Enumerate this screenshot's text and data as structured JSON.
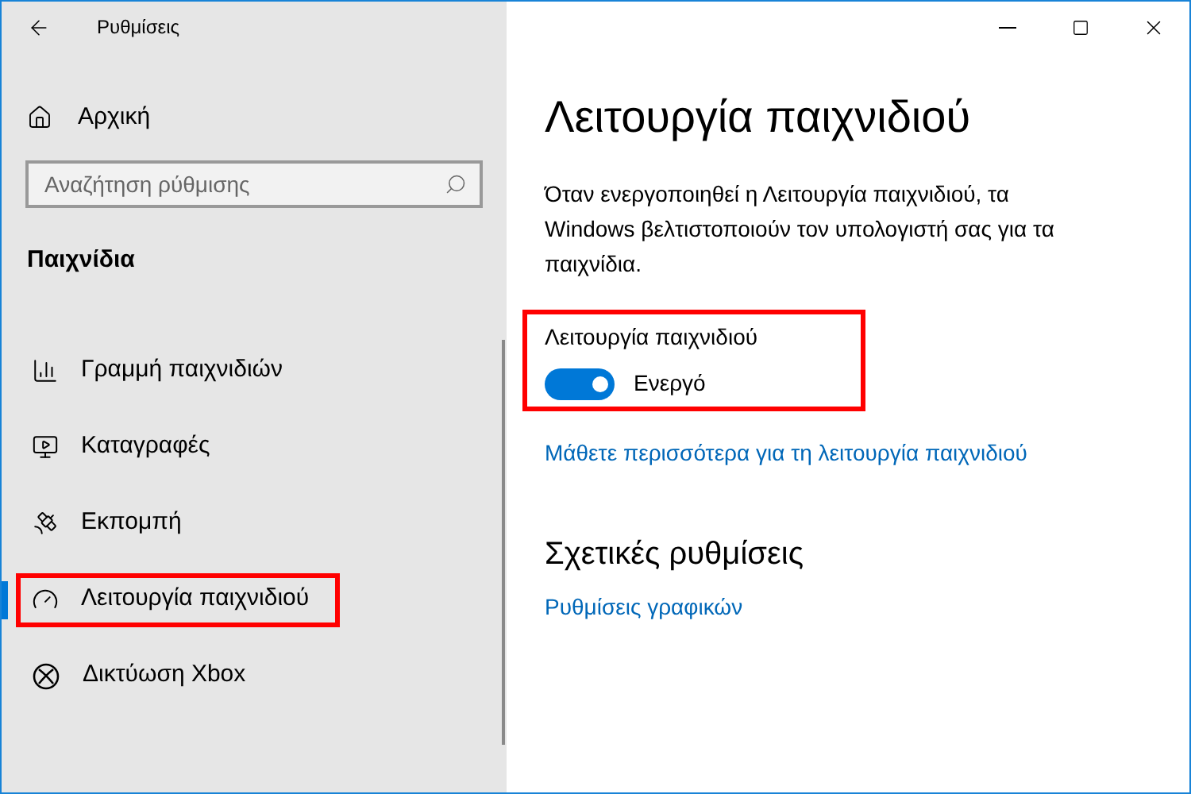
{
  "window": {
    "title": "Ρυθμίσεις"
  },
  "sidebar": {
    "home": "Αρχική",
    "search": {
      "placeholder": "Αναζήτηση ρύθμισης"
    },
    "section": "Παιχνίδια",
    "items": [
      {
        "kind": "gamebar",
        "label": "Γραμμή παιχνιδιών",
        "selected": false,
        "annotated": false
      },
      {
        "kind": "captures",
        "label": "Καταγραφές",
        "selected": false,
        "annotated": false
      },
      {
        "kind": "broadcast",
        "label": "Εκπομπή",
        "selected": false,
        "annotated": false
      },
      {
        "kind": "gamemode",
        "label": "Λειτουργία παιχνιδιού",
        "selected": true,
        "annotated": true
      },
      {
        "kind": "xbox",
        "label": "Δικτύωση Xbox",
        "selected": false,
        "annotated": false
      }
    ]
  },
  "content": {
    "title": "Λειτουργία παιχνιδιού",
    "description": "Όταν ενεργοποιηθεί η Λειτουργία παιχνιδιού, τα Windows βελτιστοποιούν τον υπολογιστή σας για τα παιχνίδια.",
    "toggle": {
      "label": "Λειτουργία παιχνιδιού",
      "on": true,
      "state_text": "Ενεργό",
      "annotated": true
    },
    "learn_more_link": "Μάθετε περισσότερα για τη λειτουργία παιχνιδιού",
    "related_heading": "Σχετικές ρυθμίσεις",
    "related_link": "Ρυθμίσεις γραφικών"
  }
}
